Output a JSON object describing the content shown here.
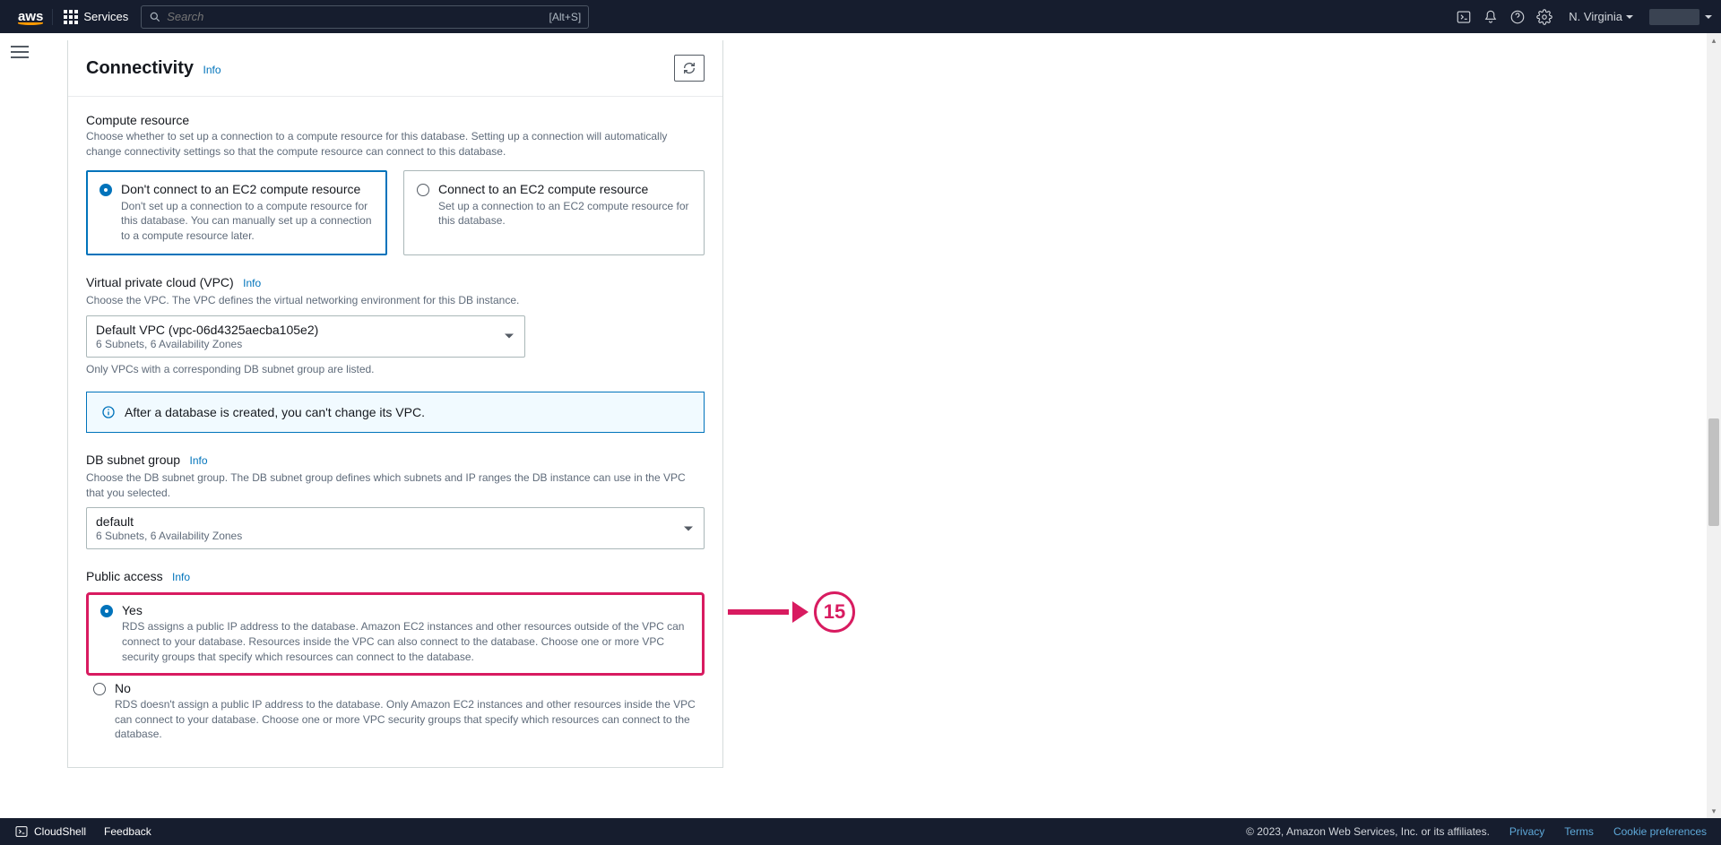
{
  "topnav": {
    "services": "Services",
    "search_placeholder": "Search",
    "search_hint": "[Alt+S]",
    "region": "N. Virginia"
  },
  "panel": {
    "title": "Connectivity",
    "info": "Info"
  },
  "compute": {
    "label": "Compute resource",
    "desc": "Choose whether to set up a connection to a compute resource for this database. Setting up a connection will automatically change connectivity settings so that the compute resource can connect to this database.",
    "opt1_title": "Don't connect to an EC2 compute resource",
    "opt1_desc": "Don't set up a connection to a compute resource for this database. You can manually set up a connection to a compute resource later.",
    "opt2_title": "Connect to an EC2 compute resource",
    "opt2_desc": "Set up a connection to an EC2 compute resource for this database."
  },
  "vpc": {
    "label": "Virtual private cloud (VPC)",
    "desc": "Choose the VPC. The VPC defines the virtual networking environment for this DB instance.",
    "selected": "Default VPC (vpc-06d4325aecba105e2)",
    "selected_sub": "6 Subnets, 6 Availability Zones",
    "hint": "Only VPCs with a corresponding DB subnet group are listed.",
    "banner": "After a database is created, you can't change its VPC."
  },
  "subnet": {
    "label": "DB subnet group",
    "desc": "Choose the DB subnet group. The DB subnet group defines which subnets and IP ranges the DB instance can use in the VPC that you selected.",
    "selected": "default",
    "selected_sub": "6 Subnets, 6 Availability Zones"
  },
  "public": {
    "label": "Public access",
    "yes_title": "Yes",
    "yes_desc": "RDS assigns a public IP address to the database. Amazon EC2 instances and other resources outside of the VPC can connect to your database. Resources inside the VPC can also connect to the database. Choose one or more VPC security groups that specify which resources can connect to the database.",
    "no_title": "No",
    "no_desc": "RDS doesn't assign a public IP address to the database. Only Amazon EC2 instances and other resources inside the VPC can connect to your database. Choose one or more VPC security groups that specify which resources can connect to the database."
  },
  "annotation": {
    "number": "15"
  },
  "footer": {
    "cloudshell": "CloudShell",
    "feedback": "Feedback",
    "copyright": "© 2023, Amazon Web Services, Inc. or its affiliates.",
    "privacy": "Privacy",
    "terms": "Terms",
    "cookie": "Cookie preferences"
  }
}
